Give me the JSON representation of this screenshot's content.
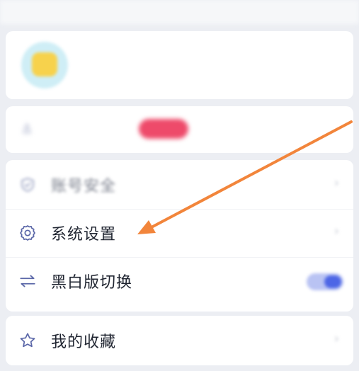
{
  "status_bar": {
    "time": "",
    "indicators": ""
  },
  "profile": {
    "username": "",
    "right_text": ""
  },
  "vip": {
    "label": "",
    "badge": ""
  },
  "menu": {
    "security_label": "账号安全",
    "settings_label": "系统设置",
    "mono_label": "黑白版切换",
    "mono_toggle_on": true
  },
  "favorites": {
    "label": "我的收藏"
  },
  "colors": {
    "accent": "#4d66e6",
    "arrow": "#f2853b",
    "badge": "#ee4a6a",
    "icon": "#5b67a8"
  },
  "icons": {
    "security": "shield-check-icon",
    "settings": "gear-icon",
    "mono": "swap-arrows-icon",
    "favorites": "star-icon",
    "chevron": "chevron-right-icon"
  }
}
